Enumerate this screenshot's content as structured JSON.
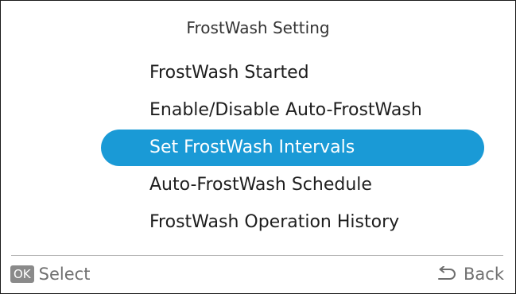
{
  "title": "FrostWash Setting",
  "menu": {
    "items": [
      {
        "label": "FrostWash Started",
        "selected": false
      },
      {
        "label": "Enable/Disable Auto-FrostWash",
        "selected": false
      },
      {
        "label": "Set FrostWash Intervals",
        "selected": true
      },
      {
        "label": "Auto-FrostWash Schedule",
        "selected": false
      },
      {
        "label": "FrostWash Operation History",
        "selected": false
      }
    ],
    "highlight_color": "#1a9ad6"
  },
  "footer": {
    "ok_badge": "OK",
    "select_label": "Select",
    "back_icon": "return-arrow-icon",
    "back_label": "Back"
  }
}
